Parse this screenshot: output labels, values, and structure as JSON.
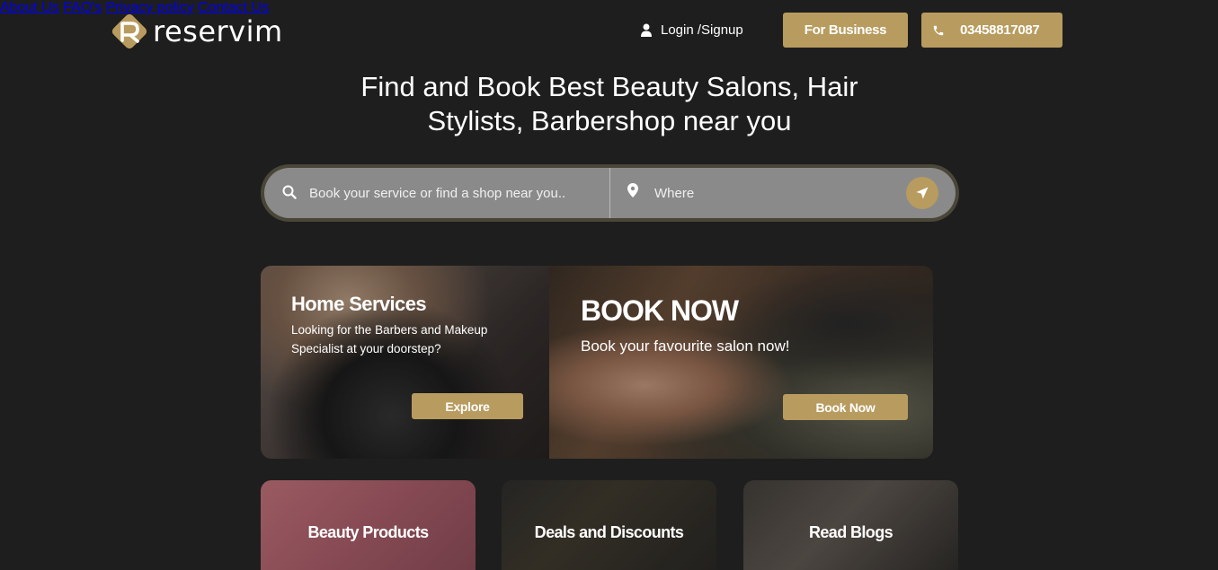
{
  "brand": {
    "name": "reservim",
    "logo_letter": "R",
    "accent": "#b89b5e",
    "background": "#1e1e1e"
  },
  "nav": {
    "items": [
      "About Us",
      "FAQ's",
      "Privacy policy",
      "Contact Us"
    ],
    "login_label": "Login /Signup",
    "login_icon": "user-icon",
    "business_label": "For Business",
    "phone_label": "03458817087",
    "phone_icon": "phone-icon"
  },
  "hero": {
    "headline_line1": "Find and Book Best Beauty Salons, Hair",
    "headline_line2": "Stylists, Barbershop near you"
  },
  "search": {
    "service_placeholder": "Book your service or find a shop near you..",
    "where_placeholder": "Where",
    "search_icon": "search-icon",
    "where_icon": "map-pin-icon",
    "locate_icon": "location-arrow-icon"
  },
  "banners": {
    "home": {
      "title": "Home Services",
      "subtitle": "Looking for the Barbers and Makeup Specialist at your doorstep?",
      "button": "Explore"
    },
    "book": {
      "title": "BOOK NOW",
      "subtitle": "Book your favourite salon now!",
      "button": "Book Now"
    }
  },
  "categories": [
    {
      "label": "Beauty Products"
    },
    {
      "label": "Deals and Discounts"
    },
    {
      "label": "Read Blogs"
    }
  ]
}
